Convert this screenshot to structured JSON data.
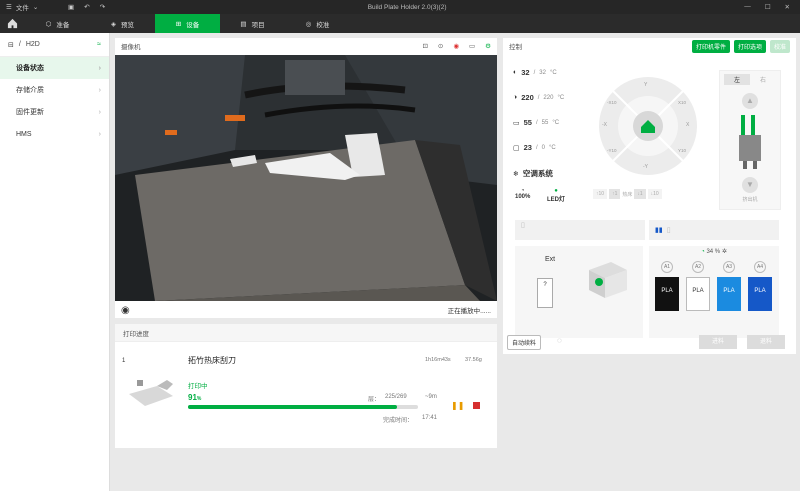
{
  "titlebar": {
    "menu": "文件",
    "title": "Build Plate Holder 2.0(3)(2)"
  },
  "nav": {
    "tabs": [
      {
        "label": "准备",
        "icon": "cube-icon"
      },
      {
        "label": "预览",
        "icon": "layers-icon"
      },
      {
        "label": "设备",
        "icon": "device-icon"
      },
      {
        "label": "项目",
        "icon": "project-icon"
      },
      {
        "label": "校准",
        "icon": "calibrate-icon"
      }
    ]
  },
  "sidebar": {
    "device": "H2D",
    "items": [
      {
        "label": "设备状态"
      },
      {
        "label": "存储介质"
      },
      {
        "label": "固件更新"
      },
      {
        "label": "HMS"
      }
    ]
  },
  "camera": {
    "title": "摄像机",
    "status": "正在播放中......"
  },
  "progress": {
    "title": "打印进度",
    "index": "1",
    "name": "拓竹热床刮刀",
    "time_a": "1h16m43s",
    "time_b": "37.56g",
    "state": "打印中",
    "percent": "91",
    "percent_unit": "%",
    "percent_value": 91,
    "layer_label": "层：",
    "layer": "225/269",
    "remain": "~9m",
    "finish_label": "完成时间：",
    "finish": "17:41"
  },
  "control": {
    "title": "控制",
    "btn_parts": "打印机零件",
    "btn_options": "打印选项",
    "btn_calib": "校准",
    "nozzle_left": {
      "cur": "32",
      "target": "32",
      "unit": "°C"
    },
    "nozzle_right": {
      "cur": "220",
      "target": "220",
      "unit": "°C"
    },
    "bed": {
      "cur": "55",
      "target": "55",
      "unit": "°C"
    },
    "chamber": {
      "cur": "23",
      "target": "0",
      "unit": "°C"
    },
    "aircon": "空调系统",
    "fan": "100%",
    "led": "LED灯",
    "extruder_left": "左",
    "extruder_right": "右",
    "jog": {
      "up": "Y",
      "down": "-Y",
      "left": "-X",
      "right": "X",
      "x10": "X10",
      "y10": "Y10",
      "mx10": "-X10",
      "my10": "-Y10",
      "bed": "热床",
      "val1": "10",
      "val2": "1",
      "val3": "1",
      "val4": "10"
    },
    "extruder_label": "挤出机",
    "ext_label": "Ext",
    "ext_slot": "?",
    "humidity": "34",
    "humidity_unit": "%",
    "slots": [
      {
        "id": "A1",
        "type": "PLA",
        "color": "#111111"
      },
      {
        "id": "A2",
        "type": "PLA",
        "color": "#ffffff"
      },
      {
        "id": "A3",
        "type": "PLA",
        "color": "#1b8be0"
      },
      {
        "id": "A4",
        "type": "PLA",
        "color": "#1558c8"
      }
    ],
    "auto_refill": "自动续料",
    "load": "进料",
    "unload": "退料"
  },
  "colors": {
    "accent": "#00ae42"
  }
}
